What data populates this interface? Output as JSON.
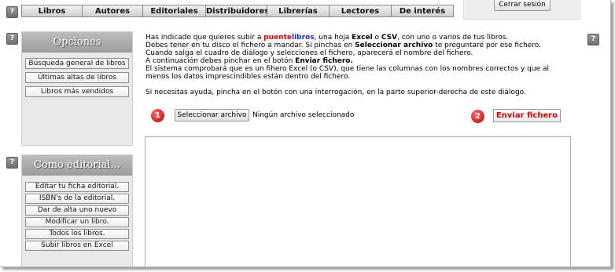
{
  "nav": {
    "tabs": [
      {
        "label": "Libros"
      },
      {
        "label": "Autores"
      },
      {
        "label": "Editoriales"
      },
      {
        "label": "Distribuidores"
      },
      {
        "label": "Librerías"
      },
      {
        "label": "Lectores"
      },
      {
        "label": "De interés"
      }
    ]
  },
  "session": {
    "logout_label": "Cerrar sesión"
  },
  "help_glyph": "?",
  "opciones": {
    "title": "Opciones",
    "items": [
      {
        "label": "Búsqueda general de libros"
      },
      {
        "label": "Últimas altas de libros"
      },
      {
        "label": "Libros más vendidos"
      }
    ]
  },
  "editorial": {
    "title": "Como editorial...",
    "items": [
      {
        "label": "Editar tu ficha editorial."
      },
      {
        "label": "ISBN's de la editorial."
      },
      {
        "label": "Dar de alta uno nuevo"
      },
      {
        "label": "Modificar un libro."
      },
      {
        "label": "Todos los libros."
      },
      {
        "label": "Subir libros en Excel"
      }
    ]
  },
  "content": {
    "intro_a": "Has indicado que quieres subir a ",
    "brand_red": "puente",
    "brand_blue": "libros",
    "intro_b": ", una hoja ",
    "excel": "Excel",
    "intro_c": " o ",
    "csv": "CSV",
    "intro_d": ", con uno o varios de tus libros.",
    "line2_a": "Debes tener en tu disco el fichero a mandar. Si pinchas en ",
    "line2_b": "Seleccionar archivo",
    "line2_c": " te preguntaré por ese fichero.",
    "line3": "Cuando salga el cuadro de diálogo y selecciones el fichero, aparecerá el nombre del fichero.",
    "line4_a": "A continuación debes pinchar en el botón ",
    "line4_b": "Enviar fichero.",
    "line5": "El sistema comprobará que es un fihero Excel (o CSV), que tiene las columnas con los nombres correctos y que al menos los datos imprescindibles están dentro del fichero.",
    "help_line": "Si necesitas ayuda, pincha en el botón con una interrogación, en la parte superior-derecha de este diálogo."
  },
  "upload": {
    "step1": "1",
    "step2": "2",
    "select_label": "Seleccionar archivo",
    "file_status": "Ningún archivo seleccionado",
    "send_label": "Enviar fichero"
  }
}
